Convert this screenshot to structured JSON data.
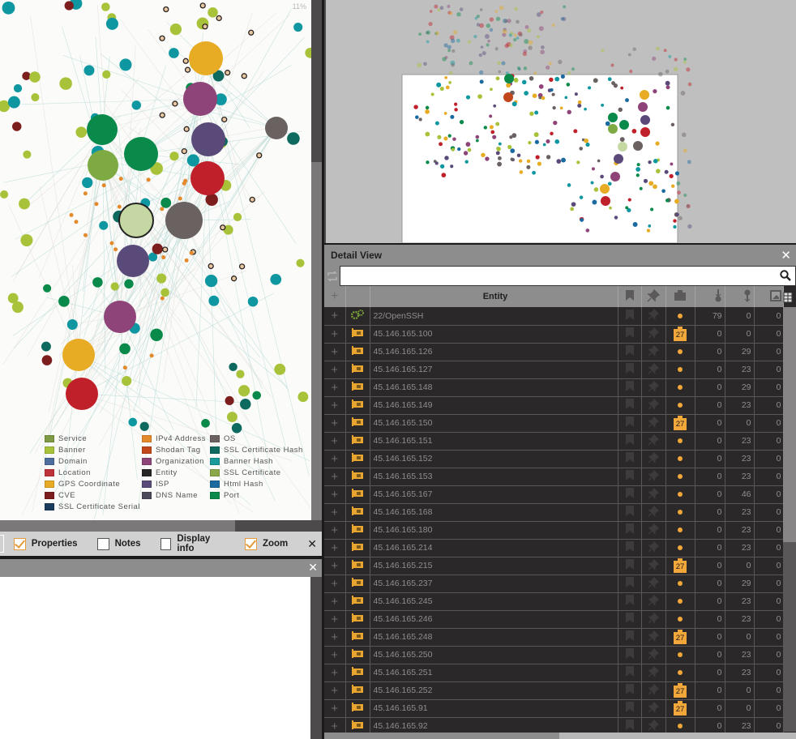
{
  "graph": {
    "zoom_label": "11%",
    "legend": [
      [
        {
          "label": "Service",
          "color": "#7e9a44"
        },
        {
          "label": "Banner",
          "color": "#a8c33a"
        },
        {
          "label": "Domain",
          "color": "#4e6ea0"
        },
        {
          "label": "Location",
          "color": "#c0323a"
        },
        {
          "label": "GPS Coordinate",
          "color": "#e7ab24"
        },
        {
          "label": "CVE",
          "color": "#7c1e1e"
        },
        {
          "label": "SSL Certificate Serial",
          "color": "#1c3c5e"
        }
      ],
      [
        {
          "label": "IPv4 Address",
          "color": "#e58a2c"
        },
        {
          "label": "Shodan Tag",
          "color": "#c2461b"
        },
        {
          "label": "Organization",
          "color": "#8e4478"
        },
        {
          "label": "Entity",
          "color": "#262626"
        },
        {
          "label": "ISP",
          "color": "#5a4a7a"
        },
        {
          "label": "DNS Name",
          "color": "#4a4a5a"
        }
      ],
      [
        {
          "label": "OS",
          "color": "#6a6261"
        },
        {
          "label": "SSL Certificate Hash",
          "color": "#0e6a5e"
        },
        {
          "label": "Banner Hash",
          "color": "#1a9a9a"
        },
        {
          "label": "SSL Certificate",
          "color": "#8aa84a"
        },
        {
          "label": "Html Hash",
          "color": "#1a6aa0"
        },
        {
          "label": "Port",
          "color": "#0a8a4a"
        }
      ]
    ]
  },
  "toolbar": {
    "items": [
      {
        "label": "Properties",
        "checked": true
      },
      {
        "label": "Notes",
        "checked": false
      },
      {
        "label": "Display info",
        "checked": false
      },
      {
        "label": "Zoom",
        "checked": true
      }
    ],
    "close_glyph": "✕"
  },
  "bottom_panel": {
    "close_glyph": "✕"
  },
  "detail_view": {
    "title": "Detail View",
    "close_glyph": "✕",
    "search": {
      "value": "",
      "placeholder": ""
    },
    "columns": {
      "add": "+",
      "entity": "Entity",
      "icons": [
        "bookmark-icon",
        "pin-icon",
        "case-icon",
        "incoming-links-icon",
        "outgoing-links-icon",
        "image-icon"
      ]
    },
    "rows": [
      {
        "type": "service",
        "entity": "22/OpenSSH",
        "case": "dot",
        "in": "79",
        "out": "0",
        "img": "0"
      },
      {
        "type": "ipv4",
        "entity": "45.146.165.100",
        "case": "27",
        "in": "0",
        "out": "0",
        "img": "0"
      },
      {
        "type": "ipv4",
        "entity": "45.146.165.126",
        "case": "dot",
        "in": "0",
        "out": "29",
        "img": "0"
      },
      {
        "type": "ipv4",
        "entity": "45.146.165.127",
        "case": "dot",
        "in": "0",
        "out": "23",
        "img": "0"
      },
      {
        "type": "ipv4",
        "entity": "45.146.165.148",
        "case": "dot",
        "in": "0",
        "out": "29",
        "img": "0"
      },
      {
        "type": "ipv4",
        "entity": "45.146.165.149",
        "case": "dot",
        "in": "0",
        "out": "23",
        "img": "0"
      },
      {
        "type": "ipv4",
        "entity": "45.146.165.150",
        "case": "27",
        "in": "0",
        "out": "0",
        "img": "0"
      },
      {
        "type": "ipv4",
        "entity": "45.146.165.151",
        "case": "dot",
        "in": "0",
        "out": "23",
        "img": "0"
      },
      {
        "type": "ipv4",
        "entity": "45.146.165.152",
        "case": "dot",
        "in": "0",
        "out": "23",
        "img": "0"
      },
      {
        "type": "ipv4",
        "entity": "45.146.165.153",
        "case": "dot",
        "in": "0",
        "out": "23",
        "img": "0"
      },
      {
        "type": "ipv4",
        "entity": "45.146.165.167",
        "case": "dot",
        "in": "0",
        "out": "46",
        "img": "0"
      },
      {
        "type": "ipv4",
        "entity": "45.146.165.168",
        "case": "dot",
        "in": "0",
        "out": "23",
        "img": "0"
      },
      {
        "type": "ipv4",
        "entity": "45.146.165.180",
        "case": "dot",
        "in": "0",
        "out": "23",
        "img": "0"
      },
      {
        "type": "ipv4",
        "entity": "45.146.165.214",
        "case": "dot",
        "in": "0",
        "out": "23",
        "img": "0"
      },
      {
        "type": "ipv4",
        "entity": "45.146.165.215",
        "case": "27",
        "in": "0",
        "out": "0",
        "img": "0"
      },
      {
        "type": "ipv4",
        "entity": "45.146.165.237",
        "case": "dot",
        "in": "0",
        "out": "29",
        "img": "0"
      },
      {
        "type": "ipv4",
        "entity": "45.146.165.245",
        "case": "dot",
        "in": "0",
        "out": "23",
        "img": "0"
      },
      {
        "type": "ipv4",
        "entity": "45.146.165.246",
        "case": "dot",
        "in": "0",
        "out": "23",
        "img": "0"
      },
      {
        "type": "ipv4",
        "entity": "45.146.165.248",
        "case": "27",
        "in": "0",
        "out": "0",
        "img": "0"
      },
      {
        "type": "ipv4",
        "entity": "45.146.165.250",
        "case": "dot",
        "in": "0",
        "out": "23",
        "img": "0"
      },
      {
        "type": "ipv4",
        "entity": "45.146.165.251",
        "case": "dot",
        "in": "0",
        "out": "23",
        "img": "0"
      },
      {
        "type": "ipv4",
        "entity": "45.146.165.252",
        "case": "27",
        "in": "0",
        "out": "0",
        "img": "0"
      },
      {
        "type": "ipv4",
        "entity": "45.146.165.91",
        "case": "27",
        "in": "0",
        "out": "0",
        "img": "0"
      },
      {
        "type": "ipv4",
        "entity": "45.146.165.92",
        "case": "dot",
        "in": "0",
        "out": "23",
        "img": "0"
      }
    ]
  },
  "colors": {
    "accent": "#f2a73b",
    "service_icon": "#7ea83a",
    "panel_header": "#8e8d8d",
    "table_bg": "#2b2829"
  }
}
